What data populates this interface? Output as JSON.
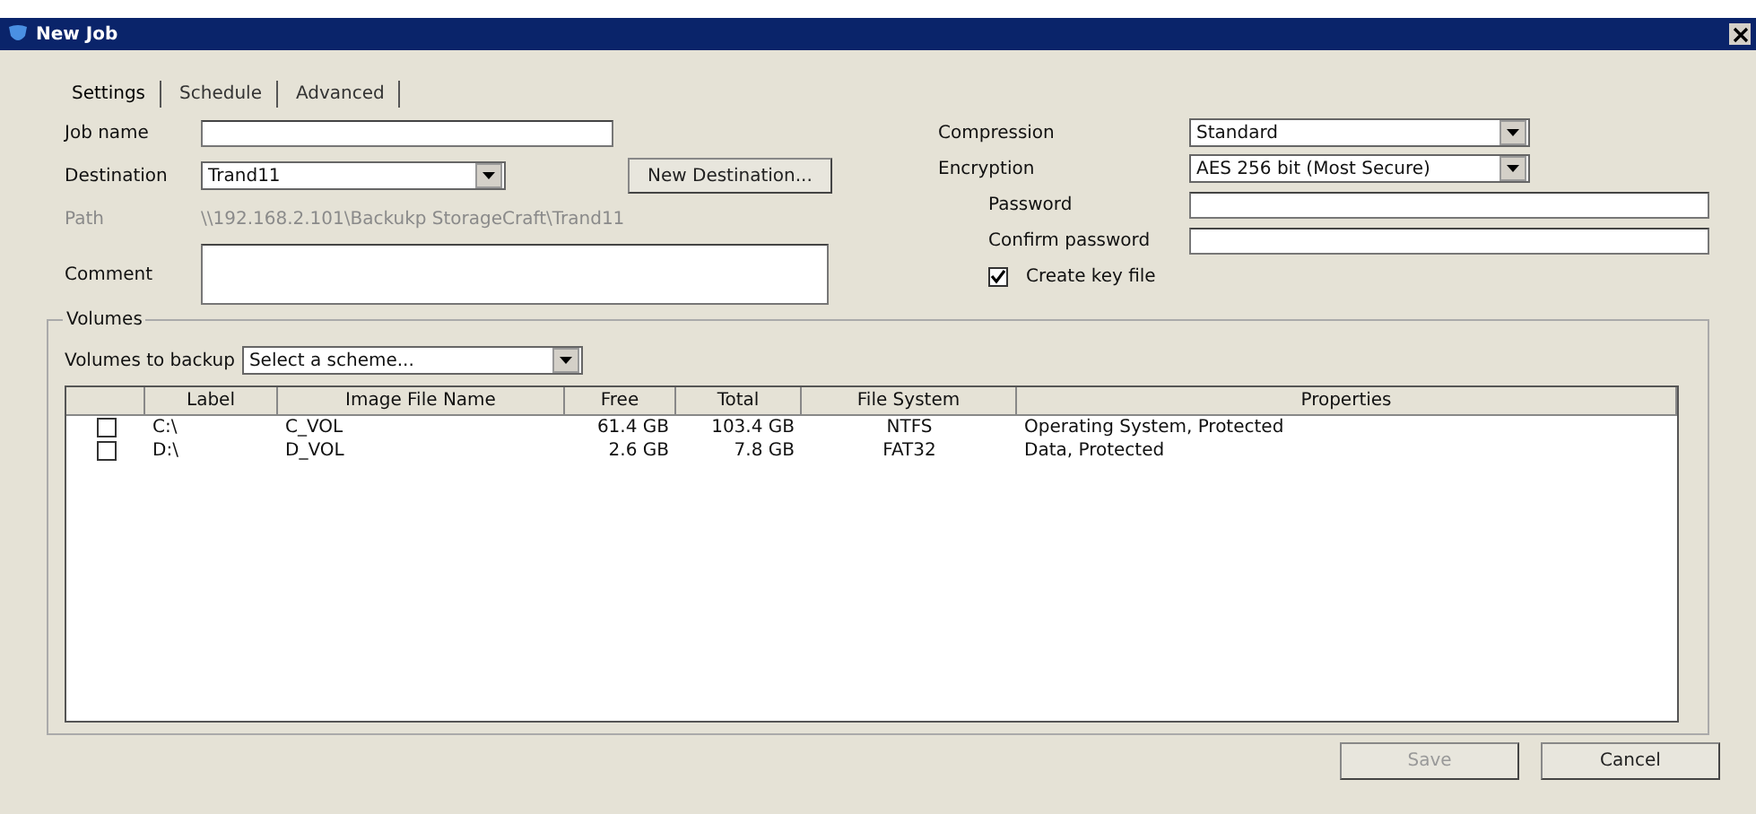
{
  "window": {
    "title": "New Job"
  },
  "tabs": [
    {
      "label": "Settings",
      "selected": true
    },
    {
      "label": "Schedule",
      "selected": false
    },
    {
      "label": "Advanced",
      "selected": false
    }
  ],
  "job_name": {
    "label": "Job name"
  },
  "destination": {
    "label": "Destination",
    "value": "Trand11",
    "button": "New Destination..."
  },
  "path": {
    "label": "Path",
    "value": "\\\\192.168.2.101\\Backukp StorageCraft\\Trand11"
  },
  "comment": {
    "label": "Comment"
  },
  "compression": {
    "label": "Compression",
    "value": "Standard"
  },
  "encryption": {
    "label": "Encryption",
    "value": "AES 256 bit (Most Secure)"
  },
  "password": {
    "label": "Password"
  },
  "confirm_password": {
    "label": "Confirm password"
  },
  "create_key_file": {
    "label": "Create key file",
    "checked": true
  },
  "volumes": {
    "title": "Volumes",
    "scheme_label": "Volumes to backup",
    "scheme_value": "Select a scheme...",
    "columns": [
      "Label",
      "Image File Name",
      "Free",
      "Total",
      "File System",
      "Properties"
    ],
    "rows": [
      {
        "checked": false,
        "cells": [
          "C:\\",
          "C_VOL",
          "61.4 GB",
          "103.4 GB",
          "NTFS",
          "Operating System, Protected"
        ]
      },
      {
        "checked": false,
        "cells": [
          "D:\\",
          "D_VOL",
          "2.6 GB",
          "7.8 GB",
          "FAT32",
          "Data, Protected"
        ]
      }
    ]
  },
  "buttons": [
    {
      "label": "Save",
      "disabled": true
    },
    {
      "label": "Cancel",
      "disabled": false
    }
  ]
}
